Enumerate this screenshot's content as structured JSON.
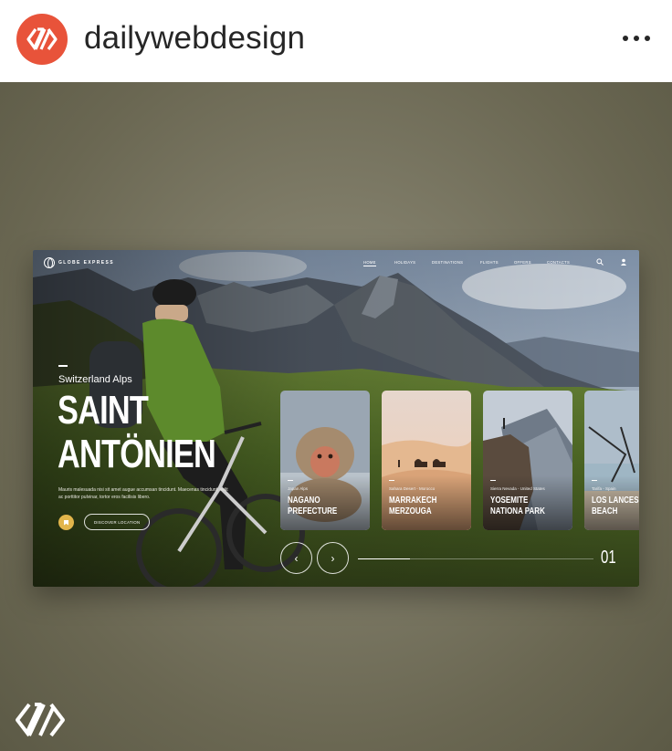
{
  "instagram": {
    "username": "dailywebdesign",
    "avatar_icon": "dailywebdesign-logo-icon",
    "more_icon": "more-options-icon",
    "accent": "#e8533a"
  },
  "site": {
    "logo_text": "GLOBE EXPRESS",
    "nav": [
      {
        "label": "HOME",
        "active": true
      },
      {
        "label": "HOLIDAYS"
      },
      {
        "label": "DESTINATIONS"
      },
      {
        "label": "FLIGHTS"
      },
      {
        "label": "OFFERS"
      },
      {
        "label": "CONTACTS"
      }
    ],
    "search_icon": "search-icon",
    "user_icon": "user-icon",
    "hero": {
      "subtitle": "Switzerland Alps",
      "title_line1": "SAINT",
      "title_line2": "ANTÖNIEN",
      "description": "Mauris malesuada nisi sit amet augue accumsan tincidunt. Maecenas tincidunt, velit ac porttitor pulvinar, tortor eros facilisis libero.",
      "discover_label": "DISCOVER LOCATION",
      "bookmark_icon": "bookmark-icon",
      "bookmark_color": "#e2b54b"
    },
    "cards": [
      {
        "location": "Japan Alps",
        "title_line1": "NAGANO",
        "title_line2": "PREFECTURE"
      },
      {
        "location": "Sahara Desert - Morocco",
        "title_line1": "MARRAKECH",
        "title_line2": "MERZOUGA"
      },
      {
        "location": "Sierra Nevada - United States",
        "title_line1": "YOSEMITE",
        "title_line2": "NATIONA PARK"
      },
      {
        "location": "Tarifa - Spain",
        "title_line1": "LOS LANCES",
        "title_line2": "BEACH"
      }
    ],
    "prev_label": "‹",
    "next_label": "›",
    "page_number": "01",
    "progress": 0.22
  }
}
